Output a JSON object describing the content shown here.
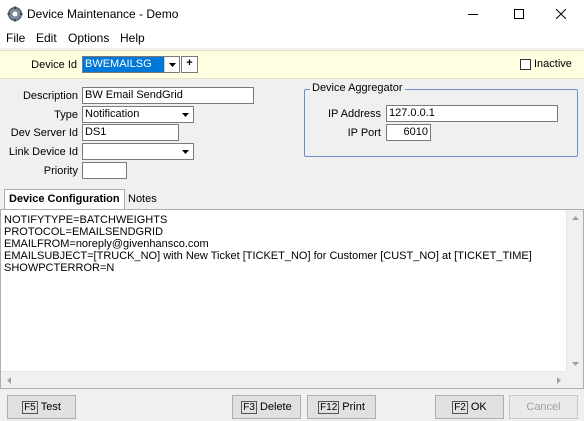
{
  "window": {
    "title": "Device Maintenance - Demo",
    "minimize_glyph": "—",
    "maximize_glyph": "☐",
    "close_glyph": "✕"
  },
  "menu": [
    "File",
    "Edit",
    "Options",
    "Help"
  ],
  "header": {
    "device_id_label": "Device Id",
    "device_id_value": "BWEMAILSG",
    "add_glyph": "+",
    "inactive_label": "Inactive",
    "inactive_checked": false
  },
  "form": {
    "description_label": "Description",
    "description_value": "BW Email SendGrid",
    "type_label": "Type",
    "type_value": "Notification",
    "dev_server_id_label": "Dev Server Id",
    "dev_server_id_value": "DS1",
    "link_device_id_label": "Link Device Id",
    "link_device_id_value": "",
    "priority_label": "Priority",
    "priority_value": ""
  },
  "aggregator": {
    "title": "Device Aggregator",
    "ip_address_label": "IP Address",
    "ip_address_value": "127.0.0.1",
    "ip_port_label": "IP Port",
    "ip_port_value": "6010"
  },
  "tabs": [
    {
      "label": "Device Configuration",
      "active": true
    },
    {
      "label": "Notes",
      "active": false
    }
  ],
  "config_lines": [
    "NOTIFYTYPE=BATCHWEIGHTS",
    "PROTOCOL=EMAILSENDGRID",
    "EMAILFROM=noreply@givenhansco.com",
    "EMAILSUBJECT=[TRUCK_NO] with New Ticket [TICKET_NO] for Customer [CUST_NO] at [TICKET_TIME]",
    "SHOWPCTERROR=N"
  ],
  "buttons": {
    "test": {
      "fkey": "F5",
      "label": "Test"
    },
    "delete": {
      "fkey": "F3",
      "label": "Delete"
    },
    "print": {
      "fkey": "F12",
      "label": "Print"
    },
    "ok": {
      "fkey": "F2",
      "label": "OK"
    },
    "cancel": {
      "label": "Cancel"
    }
  }
}
